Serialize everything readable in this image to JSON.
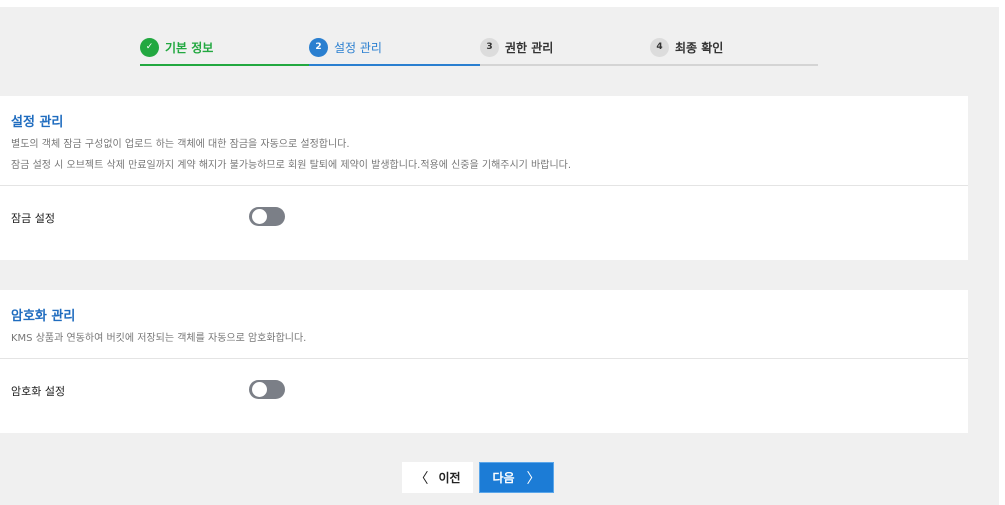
{
  "stepper": {
    "steps": [
      {
        "number": "✓",
        "label": "기본 정보",
        "state": "done"
      },
      {
        "number": "2",
        "label": "설정 관리",
        "state": "active"
      },
      {
        "number": "3",
        "label": "권한 관리",
        "state": "pending"
      },
      {
        "number": "4",
        "label": "최종 확인",
        "state": "pending"
      }
    ]
  },
  "settings": {
    "title": "설정 관리",
    "desc1": "별도의 객체 잠금 구성없이 업로드 하는 객체에 대한 잠금을 자동으로 설정합니다.",
    "desc2": "잠금 설정 시 오브젝트 삭제 만료일까지 계약 해지가 불가능하므로 회원 탈퇴에 제약이 발생합니다.적용에 신중을 기해주시기 바랍니다.",
    "lock_label": "잠금 설정",
    "lock_enabled": false
  },
  "encryption": {
    "title": "암호화 관리",
    "desc": "KMS 상품과 연동하여 버킷에 저장되는 객체를 자동으로 암호화합니다.",
    "encrypt_label": "암호화 설정",
    "encrypt_enabled": false
  },
  "footer": {
    "prev_label": "이전",
    "next_label": "다음"
  },
  "colors": {
    "done": "#22a840",
    "active": "#2a7fd0",
    "primary_button": "#1c7cd6",
    "toggle_off": "#7b7f87"
  }
}
